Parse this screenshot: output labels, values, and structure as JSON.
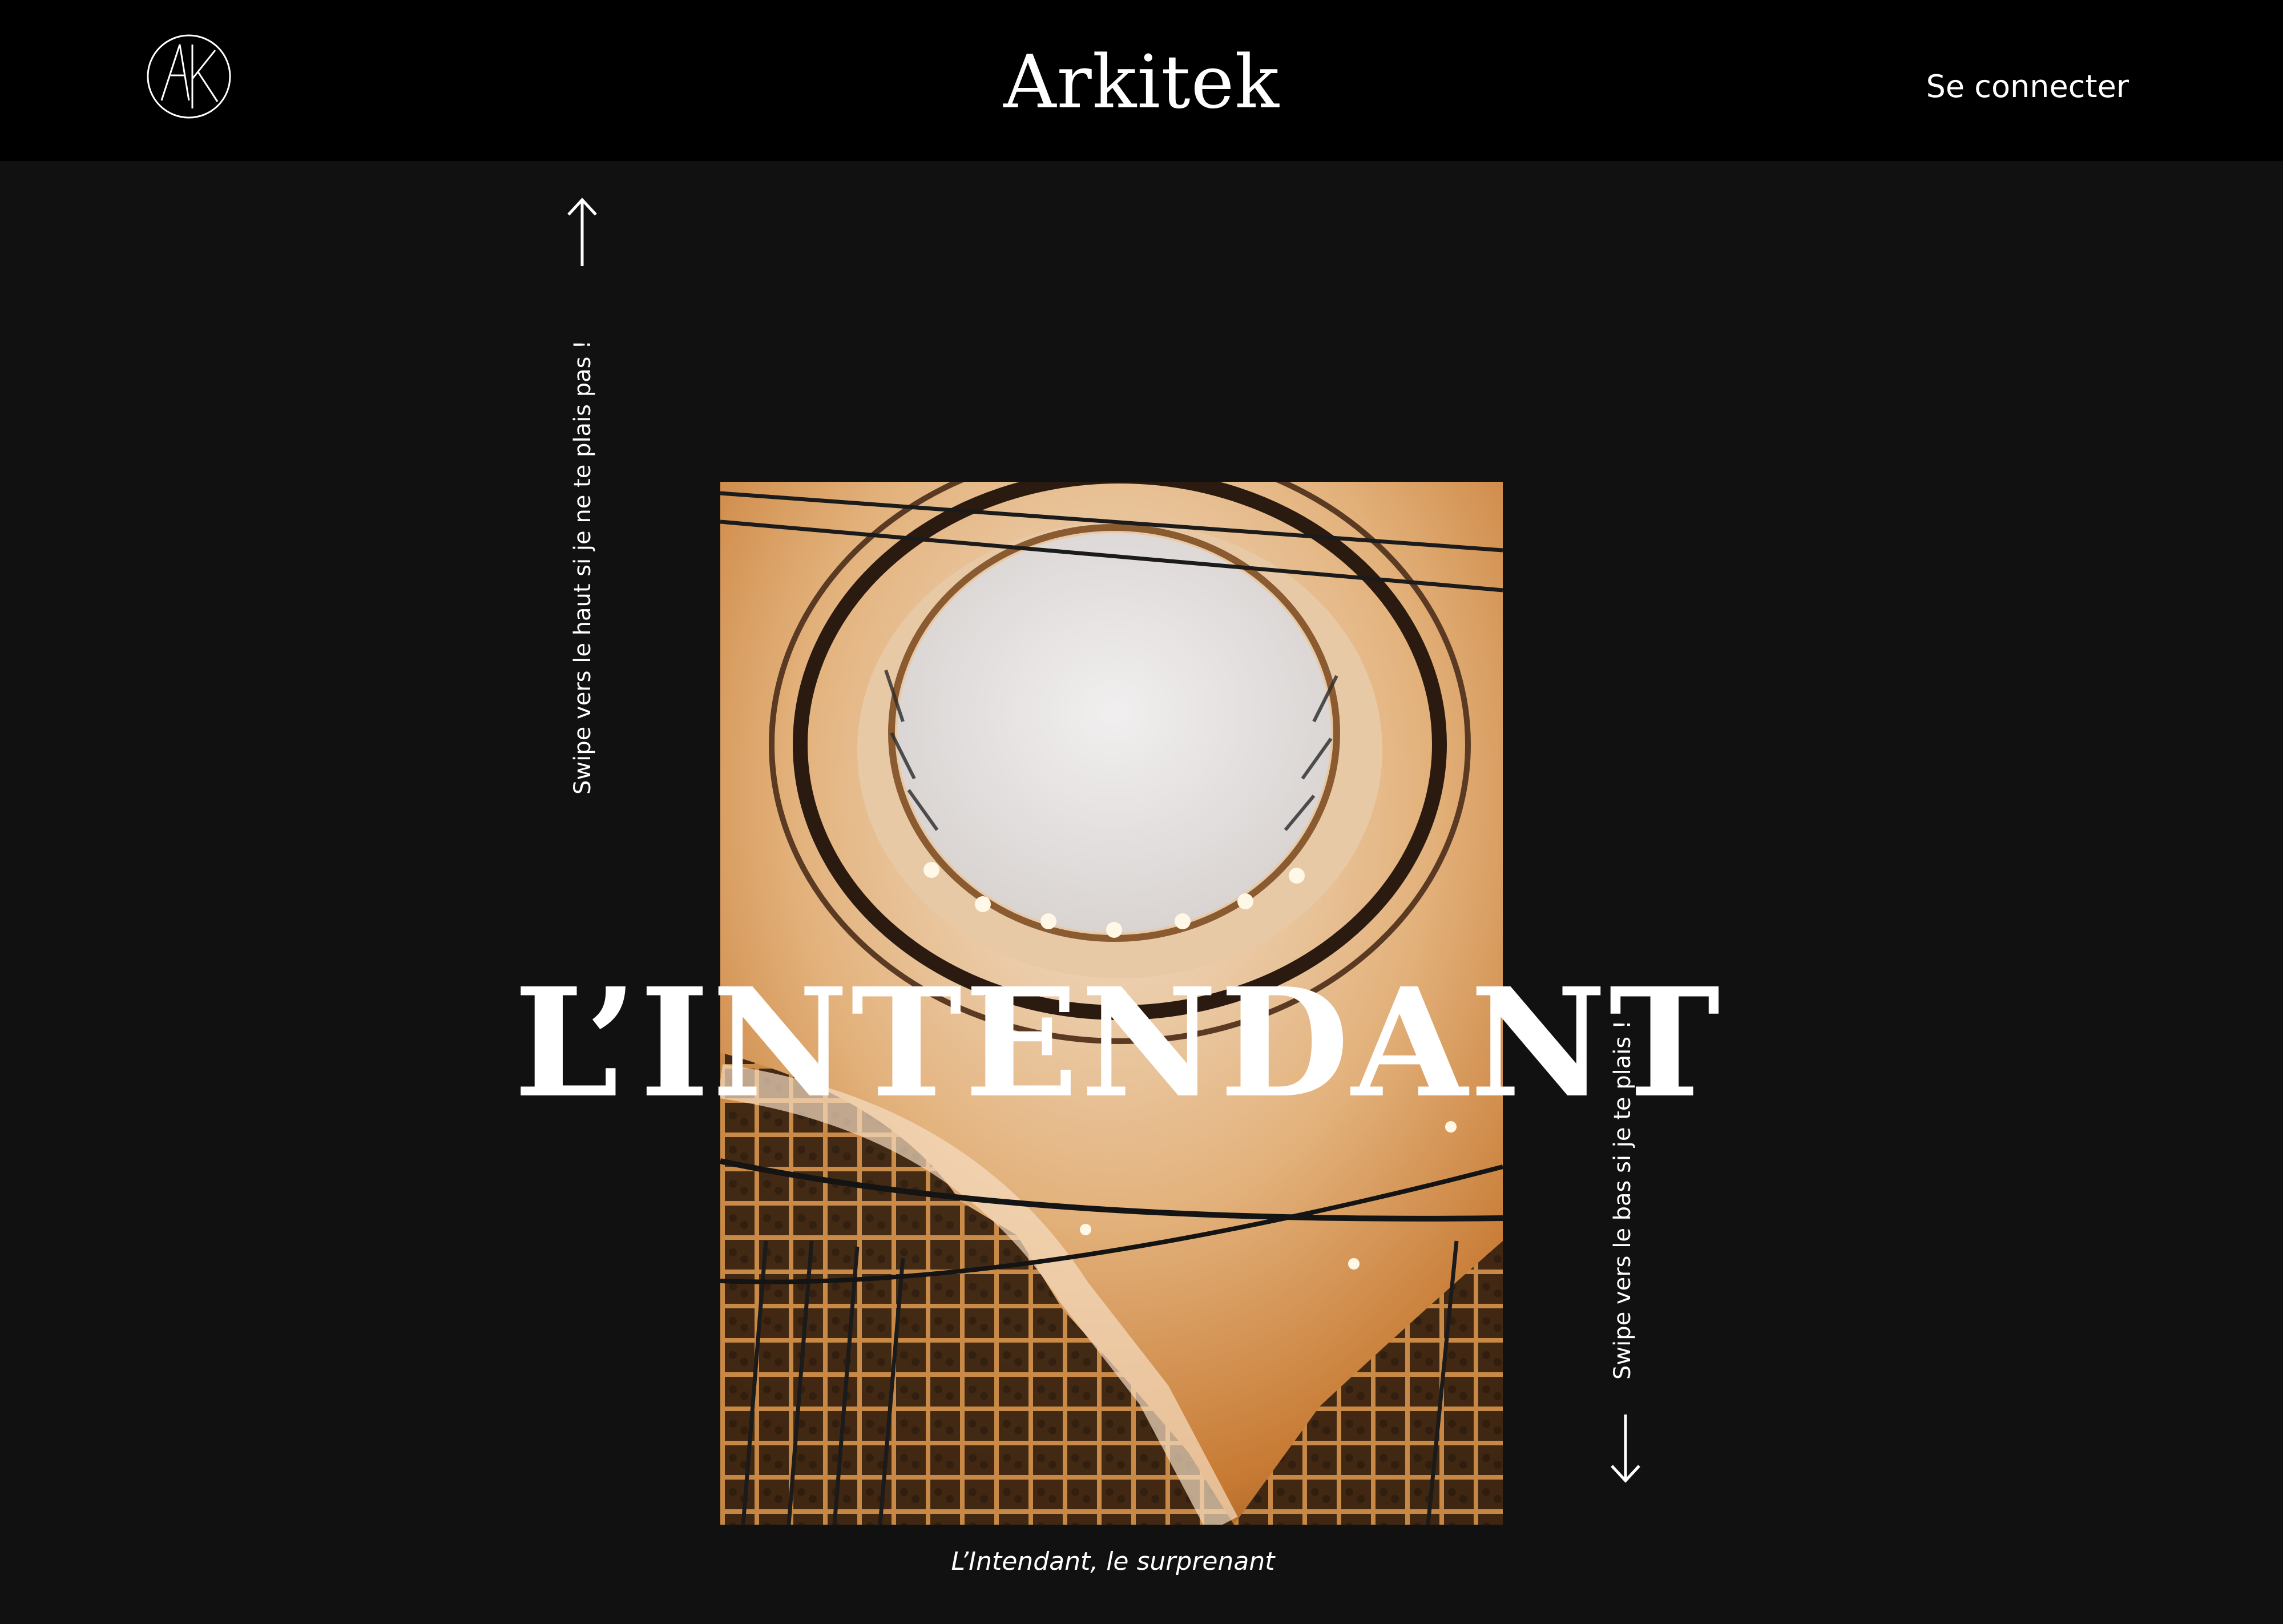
{
  "header": {
    "brand": "Arkitek",
    "login_label": "Se connecter",
    "logo_icon": "ak-monogram-icon"
  },
  "main": {
    "swipe_up_text": "Swipe vers le haut si je ne te plais pas !",
    "swipe_down_text": "Swipe vers le bas si je te plais !",
    "title": "L’INTENDANT",
    "caption": "L’Intendant, le surprenant",
    "photo_icon": "spiral-staircase-wine-cellar-photo",
    "up_icon": "arrow-up-icon",
    "down_icon": "arrow-down-icon"
  },
  "colors": {
    "header_bg": "#000000",
    "page_bg": "#111111",
    "text": "#ffffff",
    "accent_blue": "#3a7fc4",
    "wood": "#c8742a"
  }
}
